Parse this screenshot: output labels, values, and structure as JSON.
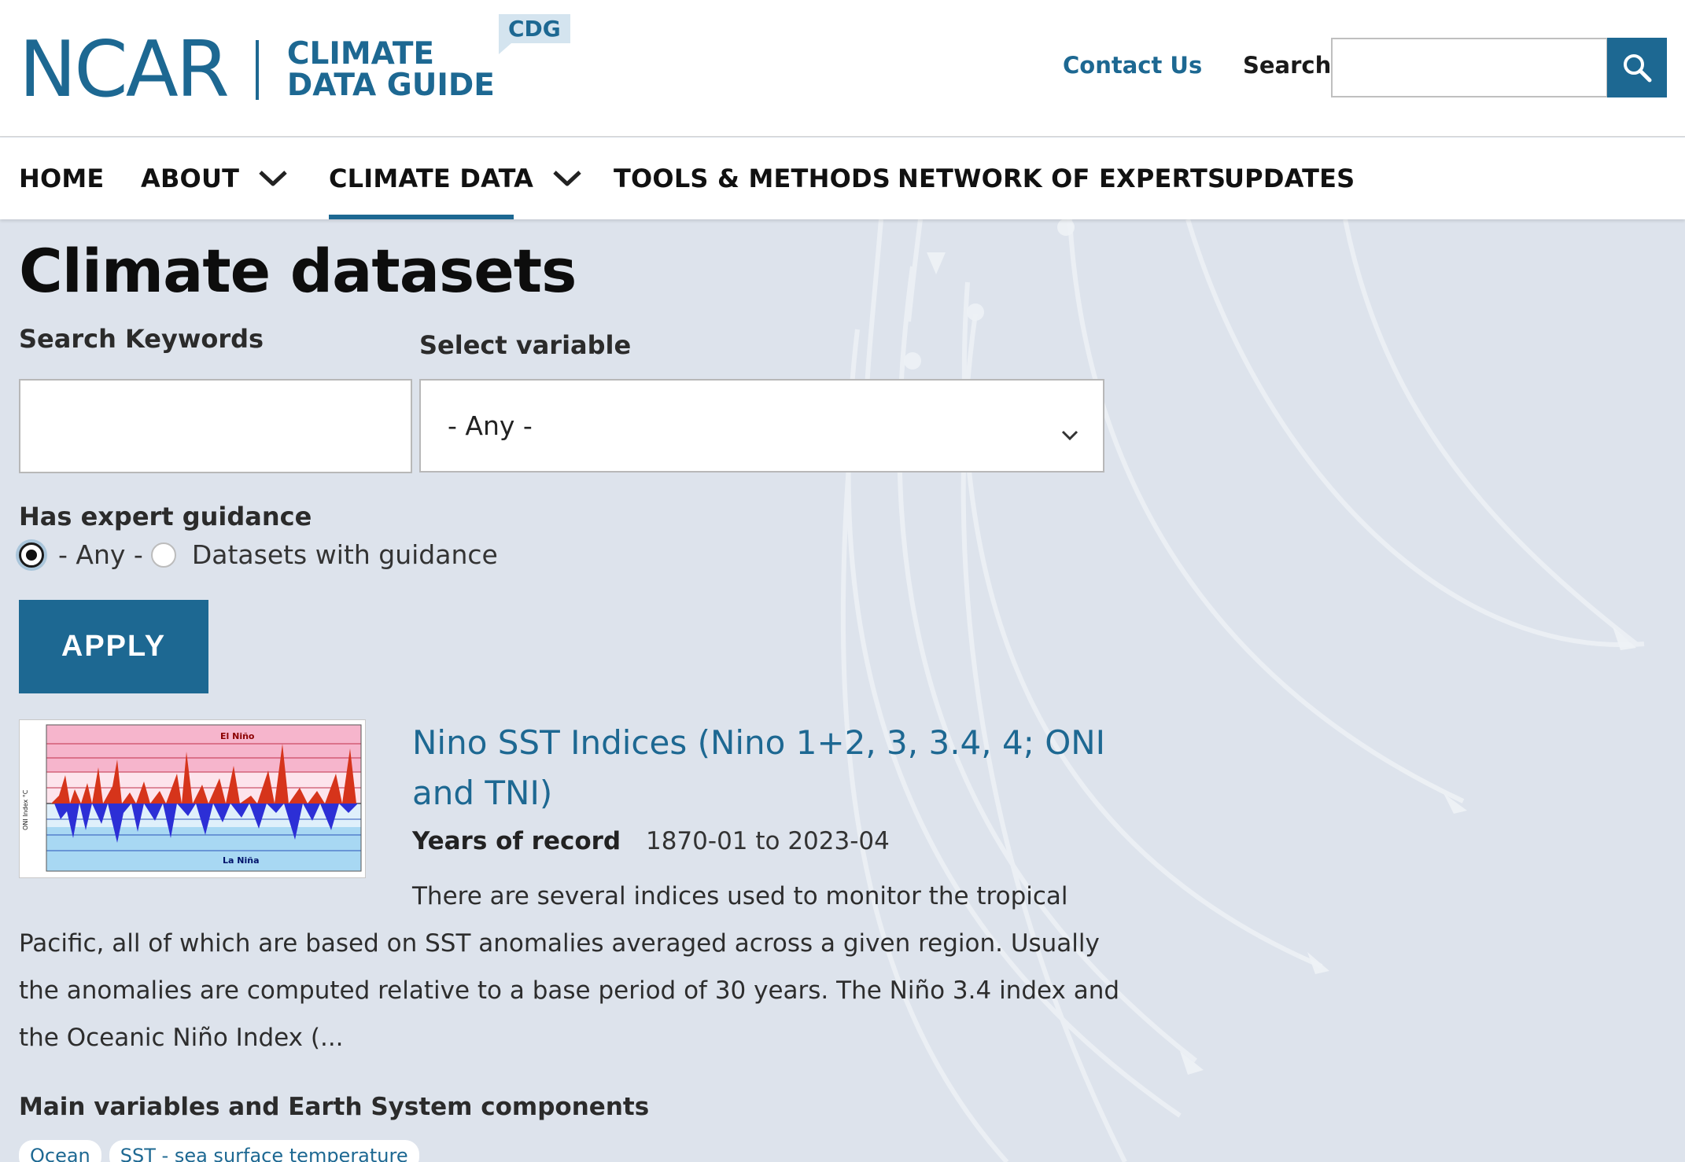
{
  "header": {
    "logo_main": "NCAR",
    "logo_line1": "CLIMATE",
    "logo_line2": "DATA GUIDE",
    "badge": "CDG",
    "contact": "Contact Us",
    "search_label": "Search",
    "search_placeholder": ""
  },
  "nav": {
    "items": [
      {
        "label": "HOME",
        "dropdown": false,
        "active": false
      },
      {
        "label": "ABOUT",
        "dropdown": true,
        "active": false
      },
      {
        "label": "CLIMATE DATA",
        "dropdown": true,
        "active": true
      },
      {
        "label": "TOOLS & METHODS",
        "dropdown": false,
        "active": false
      },
      {
        "label": "NETWORK OF EXPERTS",
        "dropdown": false,
        "active": false
      },
      {
        "label": "UPDATES",
        "dropdown": false,
        "active": false
      }
    ]
  },
  "filters": {
    "title": "Climate datasets",
    "keywords_label": "Search Keywords",
    "keywords_value": "",
    "variable_label": "Select variable",
    "variable_value": "- Any -",
    "guidance_label": "Has expert guidance",
    "guidance_options": [
      "- Any -",
      "Datasets with guidance"
    ],
    "guidance_selected": 0,
    "apply": "APPLY"
  },
  "result": {
    "title": "Nino SST Indices (Nino 1+2, 3, 3.4, 4; ONI and TNI)",
    "years_label": "Years of record",
    "years_value": "1870-01 to 2023-04",
    "description_first": "There are several indices used to monitor the tropical",
    "description_rest": "Pacific, all of which are based on SST anomalies averaged across a given region.  Usually the anomalies are computed relative to a base period of 30 years.  The Niño 3.4 index and the Oceanic Niño Index (...",
    "vars_label": "Main variables and Earth System components",
    "tags": [
      "Ocean",
      "SST - sea surface temperature"
    ],
    "thumb": {
      "el_nino": "El Niño",
      "la_nina": "La Niña",
      "ylabel": "ONI Index °C"
    }
  },
  "colors": {
    "brand": "#1d6892",
    "background": "#dde3ec"
  }
}
